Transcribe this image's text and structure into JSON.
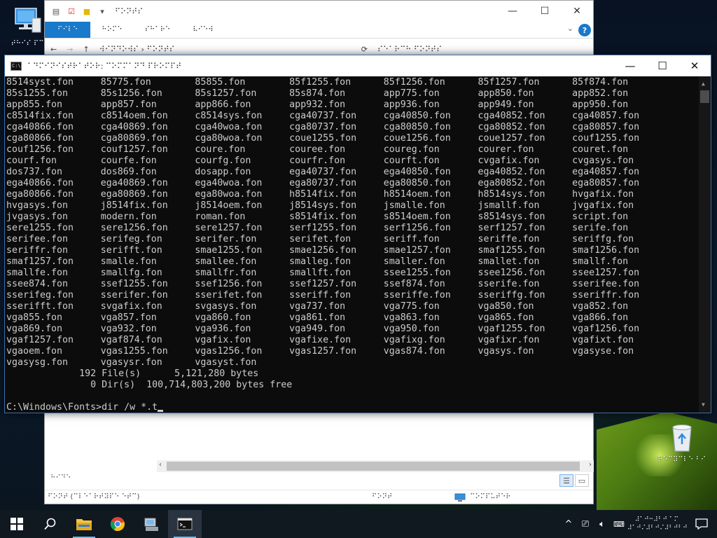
{
  "desktop": {
    "icons": [
      {
        "label": "⠞⠓⠊⠎ ⠏⠉",
        "icon": "this-pc-icon"
      },
      {
        "label": "⠗⠑⠉⠽⠉⠇⠑ ⠃⠊⠝",
        "icon": "recycle-bin-icon"
      }
    ]
  },
  "explorer": {
    "title": "⠋⠕⠝⠞⠎",
    "ribbon_tabs": [
      "⠋⠊⠇⠑",
      "⠓⠕⠍⠑",
      "⠎⠓⠁⠗⠑",
      "⠧⠊⠑⠺"
    ],
    "address": "⠺⠊⠝⠙⠕⠺⠎ › ⠋⠕⠝⠞⠎",
    "search_placeholder": "⠎⠑⠁⠗⠉⠓ ⠋⠕⠝⠞⠎",
    "details_label": "⠓⠊⠙⠑",
    "status_left": "⠋⠕⠝⠞ (⠉⠇⠑⠁⠗⠞⠽⠏⠑ ⠑⠞⠉)",
    "status_mid": "⠋⠕⠝⠞",
    "status_right": "⠉⠕⠍⠏⠥⠞⠑⠗"
  },
  "cmd": {
    "title": "⠁⠙⠍⠊⠝⠊⠎⠞⠗⠁⠞⠕⠗: ⠉⠕⠍⠍⠁⠝⠙ ⠏⠗⠕⠍⠏⠞",
    "file_rows": [
      [
        "8514syst.fon",
        "85775.fon",
        "85855.fon",
        "85f1255.fon",
        "85f1256.fon",
        "85f1257.fon",
        "85f874.fon"
      ],
      [
        "85s1255.fon",
        "85s1256.fon",
        "85s1257.fon",
        "85s874.fon",
        "app775.fon",
        "app850.fon",
        "app852.fon"
      ],
      [
        "app855.fon",
        "app857.fon",
        "app866.fon",
        "app932.fon",
        "app936.fon",
        "app949.fon",
        "app950.fon"
      ],
      [
        "c8514fix.fon",
        "c8514oem.fon",
        "c8514sys.fon",
        "cga40737.fon",
        "cga40850.fon",
        "cga40852.fon",
        "cga40857.fon"
      ],
      [
        "cga40866.fon",
        "cga40869.fon",
        "cga40woa.fon",
        "cga80737.fon",
        "cga80850.fon",
        "cga80852.fon",
        "cga80857.fon"
      ],
      [
        "cga80866.fon",
        "cga80869.fon",
        "cga80woa.fon",
        "coue1255.fon",
        "coue1256.fon",
        "coue1257.fon",
        "couf1255.fon"
      ],
      [
        "couf1256.fon",
        "couf1257.fon",
        "coure.fon",
        "couree.fon",
        "coureg.fon",
        "courer.fon",
        "couret.fon"
      ],
      [
        "courf.fon",
        "courfe.fon",
        "courfg.fon",
        "courfr.fon",
        "courft.fon",
        "cvgafix.fon",
        "cvgasys.fon"
      ],
      [
        "dos737.fon",
        "dos869.fon",
        "dosapp.fon",
        "ega40737.fon",
        "ega40850.fon",
        "ega40852.fon",
        "ega40857.fon"
      ],
      [
        "ega40866.fon",
        "ega40869.fon",
        "ega40woa.fon",
        "ega80737.fon",
        "ega80850.fon",
        "ega80852.fon",
        "ega80857.fon"
      ],
      [
        "ega80866.fon",
        "ega80869.fon",
        "ega80woa.fon",
        "h8514fix.fon",
        "h8514oem.fon",
        "h8514sys.fon",
        "hvgafix.fon"
      ],
      [
        "hvgasys.fon",
        "j8514fix.fon",
        "j8514oem.fon",
        "j8514sys.fon",
        "jsmalle.fon",
        "jsmallf.fon",
        "jvgafix.fon"
      ],
      [
        "jvgasys.fon",
        "modern.fon",
        "roman.fon",
        "s8514fix.fon",
        "s8514oem.fon",
        "s8514sys.fon",
        "script.fon"
      ],
      [
        "sere1255.fon",
        "sere1256.fon",
        "sere1257.fon",
        "serf1255.fon",
        "serf1256.fon",
        "serf1257.fon",
        "serife.fon"
      ],
      [
        "serifee.fon",
        "serifeg.fon",
        "serifer.fon",
        "serifet.fon",
        "seriff.fon",
        "seriffe.fon",
        "seriffg.fon"
      ],
      [
        "seriffr.fon",
        "serifft.fon",
        "smae1255.fon",
        "smae1256.fon",
        "smae1257.fon",
        "smaf1255.fon",
        "smaf1256.fon"
      ],
      [
        "smaf1257.fon",
        "smalle.fon",
        "smallee.fon",
        "smalleg.fon",
        "smaller.fon",
        "smallet.fon",
        "smallf.fon"
      ],
      [
        "smallfe.fon",
        "smallfg.fon",
        "smallfr.fon",
        "smallft.fon",
        "ssee1255.fon",
        "ssee1256.fon",
        "ssee1257.fon"
      ],
      [
        "ssee874.fon",
        "ssef1255.fon",
        "ssef1256.fon",
        "ssef1257.fon",
        "ssef874.fon",
        "sserife.fon",
        "sserifee.fon"
      ],
      [
        "sserifeg.fon",
        "sserifer.fon",
        "sserifet.fon",
        "sseriff.fon",
        "sseriffe.fon",
        "sseriffg.fon",
        "sseriffr.fon"
      ],
      [
        "sserifft.fon",
        "svgafix.fon",
        "svgasys.fon",
        "vga737.fon",
        "vga775.fon",
        "vga850.fon",
        "vga852.fon"
      ],
      [
        "vga855.fon",
        "vga857.fon",
        "vga860.fon",
        "vga861.fon",
        "vga863.fon",
        "vga865.fon",
        "vga866.fon"
      ],
      [
        "vga869.fon",
        "vga932.fon",
        "vga936.fon",
        "vga949.fon",
        "vga950.fon",
        "vgaf1255.fon",
        "vgaf1256.fon"
      ],
      [
        "vgaf1257.fon",
        "vgaf874.fon",
        "vgafix.fon",
        "vgafixe.fon",
        "vgafixg.fon",
        "vgafixr.fon",
        "vgafixt.fon"
      ],
      [
        "vgaoem.fon",
        "vgas1255.fon",
        "vgas1256.fon",
        "vgas1257.fon",
        "vgas874.fon",
        "vgasys.fon",
        "vgasyse.fon"
      ],
      [
        "vgasysg.fon",
        "vgasysr.fon",
        "vgasyst.fon"
      ]
    ],
    "summary_files": "             192 File(s)      5,121,280 bytes",
    "summary_dirs": "               0 Dir(s)  100,714,803,200 bytes free",
    "prompt": "C:\\Windows\\Fonts>",
    "typed": "dir /w *.t"
  },
  "taskbar": {
    "apps": [
      {
        "name": "file-explorer",
        "icon": "folder-icon"
      },
      {
        "name": "chrome",
        "icon": "chrome-icon"
      },
      {
        "name": "network",
        "icon": "network-computer-icon"
      },
      {
        "name": "command-prompt",
        "icon": "cmd-icon"
      }
    ],
    "clock_time": "⠼⠁⠚⠒⠼⠃⠚ ⠁⠍",
    "clock_date": "⠼⠁⠚⠌⠼⠃⠚⠌⠼⠃⠚⠃⠚"
  },
  "colors": {
    "cmd_bg": "#0c0c0c",
    "cmd_fg": "#cccccc",
    "accent": "#1979ca",
    "taskbar": "#101820"
  }
}
